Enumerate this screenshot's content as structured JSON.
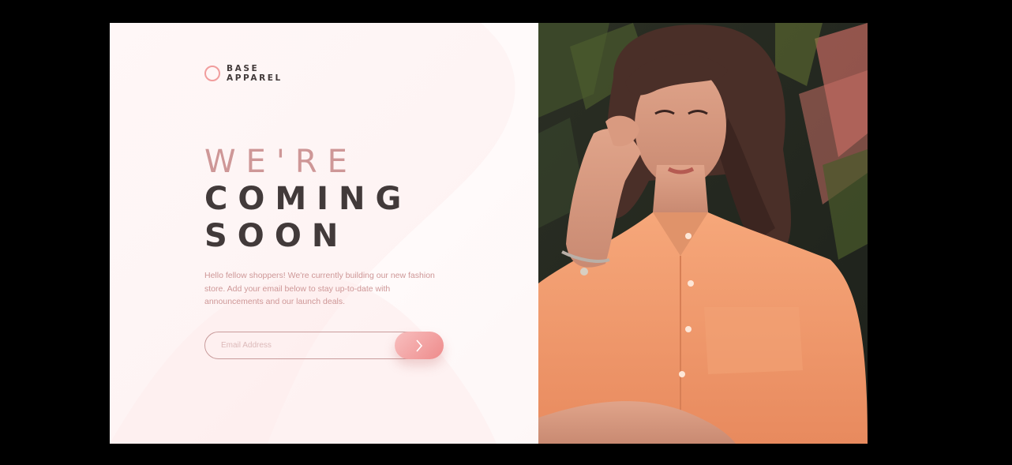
{
  "brand": {
    "line1": "BASE",
    "line2": "APPAREL",
    "accent_color": "#f19d9d"
  },
  "hero": {
    "line1": "WE'RE",
    "line2": "COMING",
    "line3": "SOON"
  },
  "intro": "Hello fellow shoppers! We're currently building our new fashion store. Add your email below to stay up-to-date with announcements and our launch deals.",
  "form": {
    "email_placeholder": "Email Address",
    "submit_icon": "chevron-right-icon"
  },
  "photo": {
    "subject": "woman in peach button-up shirt touching her hair, tropical leaves behind"
  },
  "colors": {
    "page_background": "#000000",
    "panel_background": "#fff7f7",
    "heading_light": "#ce9797",
    "heading_dark": "#423a3a",
    "button_gradient_start": "#f8bfbf",
    "button_gradient_end": "#ee8b8b"
  }
}
